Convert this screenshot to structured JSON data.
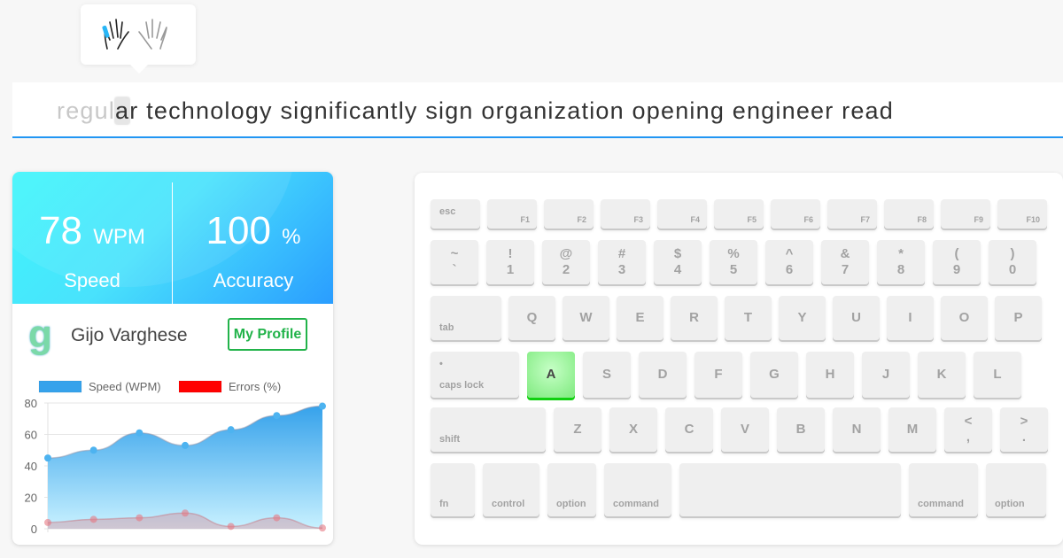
{
  "finger_hint": {
    "icon": "hands-icon",
    "active_finger": "left-pinky",
    "accent": "#29b6f6"
  },
  "typing": {
    "typed": "regul",
    "current": "a",
    "remaining": "r technology significantly sign organization opening engineer read"
  },
  "stats": {
    "speed": {
      "value": "78",
      "unit": "WPM",
      "label": "Speed"
    },
    "accuracy": {
      "value": "100",
      "unit": "%",
      "label": "Accuracy"
    }
  },
  "profile": {
    "logo": "g",
    "name": "Gijo Varghese",
    "button": "My Profile",
    "button_color": "#22b34a"
  },
  "chart_data": {
    "type": "area",
    "x": [
      1,
      2,
      3,
      4,
      5,
      6,
      7
    ],
    "series": [
      {
        "name": "Speed (WPM)",
        "values": [
          45,
          50,
          61,
          53,
          63,
          72,
          78
        ],
        "color": "#36a2eb"
      },
      {
        "name": "Errors (%)",
        "values": [
          4,
          6,
          7,
          10,
          1.5,
          7,
          0.5
        ],
        "color": "#ff0000"
      }
    ],
    "ylim": [
      0,
      80
    ],
    "yticks": [
      "0",
      "20",
      "40",
      "60",
      "80"
    ],
    "grid": true,
    "legend": "top"
  },
  "keyboard": {
    "active_key": "A",
    "active_color": "#10d010",
    "rows": [
      [
        {
          "bl": "esc"
        },
        {
          "br": "F1"
        },
        {
          "br": "F2"
        },
        {
          "br": "F3"
        },
        {
          "br": "F4"
        },
        {
          "br": "F5"
        },
        {
          "br": "F6"
        },
        {
          "br": "F7"
        },
        {
          "br": "F8"
        },
        {
          "br": "F9"
        },
        {
          "br": "F10"
        }
      ],
      [
        {
          "t": "~",
          "b": "`"
        },
        {
          "t": "!",
          "b": "1"
        },
        {
          "t": "@",
          "b": "2"
        },
        {
          "t": "#",
          "b": "3"
        },
        {
          "t": "$",
          "b": "4"
        },
        {
          "t": "%",
          "b": "5"
        },
        {
          "t": "^",
          "b": "6"
        },
        {
          "t": "&",
          "b": "7"
        },
        {
          "t": "*",
          "b": "8"
        },
        {
          "t": "(",
          "b": "9"
        },
        {
          "t": ")",
          "b": "0"
        }
      ],
      [
        {
          "bl": "tab"
        },
        {
          "c": "Q"
        },
        {
          "c": "W"
        },
        {
          "c": "E"
        },
        {
          "c": "R"
        },
        {
          "c": "T"
        },
        {
          "c": "Y"
        },
        {
          "c": "U"
        },
        {
          "c": "I"
        },
        {
          "c": "O"
        },
        {
          "c": "P"
        }
      ],
      [
        {
          "tl": "•",
          "bl": "caps lock"
        },
        {
          "c": "A"
        },
        {
          "c": "S"
        },
        {
          "c": "D"
        },
        {
          "c": "F"
        },
        {
          "c": "G"
        },
        {
          "c": "H"
        },
        {
          "c": "J"
        },
        {
          "c": "K"
        },
        {
          "c": "L"
        }
      ],
      [
        {
          "bl": "shift"
        },
        {
          "c": "Z"
        },
        {
          "c": "X"
        },
        {
          "c": "C"
        },
        {
          "c": "V"
        },
        {
          "c": "B"
        },
        {
          "c": "N"
        },
        {
          "c": "M"
        },
        {
          "t": "<",
          "b": ","
        },
        {
          "t": ">",
          "b": "."
        }
      ],
      [
        {
          "bl": "fn"
        },
        {
          "bl": "control"
        },
        {
          "bl": "option"
        },
        {
          "bl": "command"
        },
        {
          "bl": ""
        },
        {
          "bl": "command"
        },
        {
          "bl": "option"
        }
      ]
    ]
  }
}
